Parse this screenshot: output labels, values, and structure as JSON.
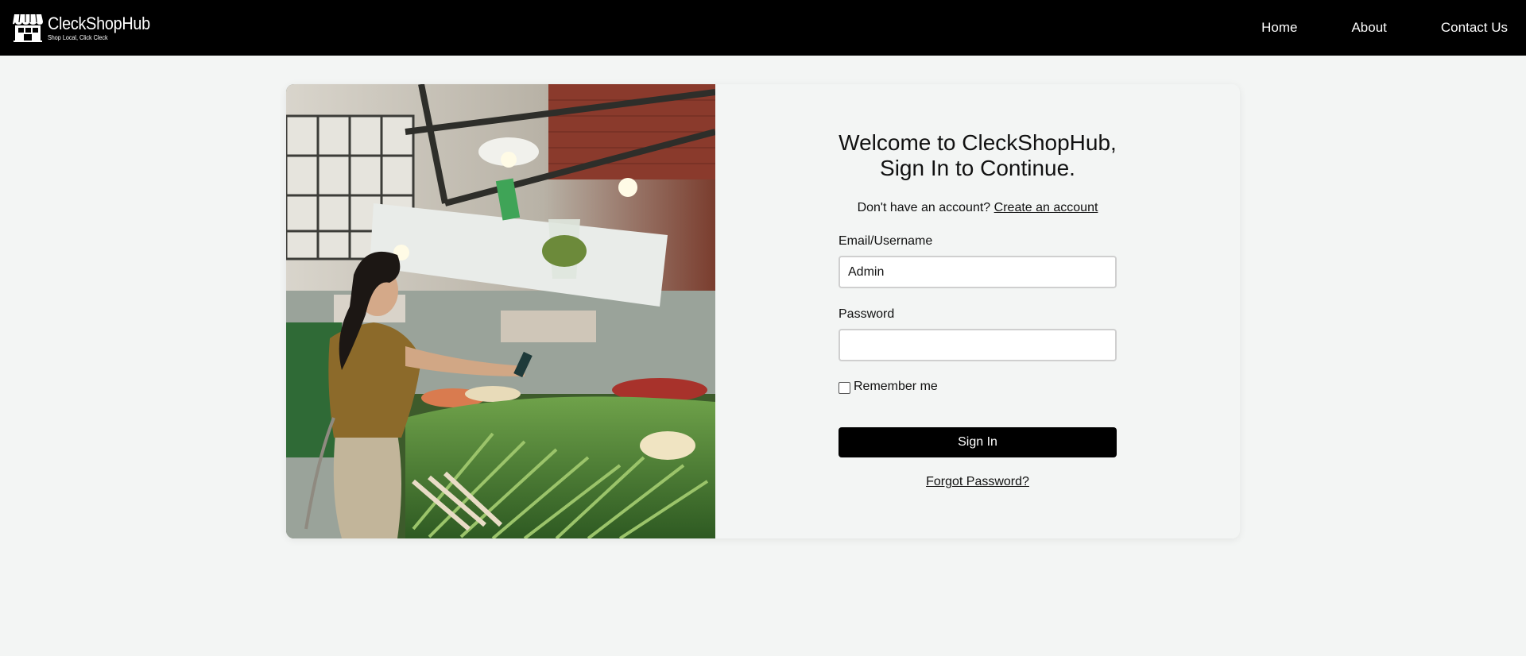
{
  "brand": {
    "name": "CleckShopHub",
    "tagline": "Shop Local, Click Cleck"
  },
  "nav": {
    "items": [
      "Home",
      "About",
      "Contact Us"
    ]
  },
  "login": {
    "heading_line1": "Welcome to CleckShopHub,",
    "heading_line2": "Sign In to Continue.",
    "no_account_text": "Don't have an account?",
    "create_account_link": "Create an account",
    "email_label": "Email/Username",
    "email_value": "Admin",
    "password_label": "Password",
    "password_value": "",
    "remember_label": "Remember me",
    "remember_checked": false,
    "signin_button": "Sign In",
    "forgot_link": "Forgot Password?"
  },
  "colors": {
    "header_bg": "#000000",
    "page_bg": "#f3f5f4",
    "button_bg": "#000000",
    "button_text": "#ffffff"
  },
  "icons": {
    "logo": "storefront-icon",
    "photo": "market-shopper-photo"
  }
}
